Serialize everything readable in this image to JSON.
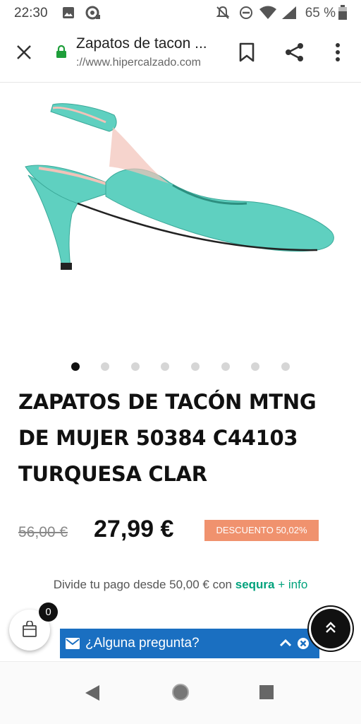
{
  "status": {
    "time": "22:30",
    "battery": "65 %"
  },
  "browser": {
    "close_icon": "close-icon",
    "page_title": "Zapatos de tacon ...",
    "url": "://www.hipercalzado.com",
    "lock_color": "#1e9e3a"
  },
  "product": {
    "image_alt": "turquoise slingback heel shoe",
    "shoe_color": "#5fd0c0",
    "gallery_count": 8,
    "gallery_active": 0,
    "title": "ZAPATOS DE TACÓN MTNG DE MUJER 50384 C44103 TURQUESA CLAR",
    "old_price": "56,00 €",
    "new_price": "27,99 €",
    "discount": "DESCUENTO 50,02%",
    "discount_color": "#f0926e"
  },
  "financing": {
    "text": "Divide tu pago desde 50,00 € con",
    "brand": "sequra",
    "link": "+ info",
    "brand_color": "#00a27c"
  },
  "cart": {
    "count": "0"
  },
  "chat": {
    "label": "¿Alguna pregunta?",
    "color": "#1a6fc1"
  }
}
